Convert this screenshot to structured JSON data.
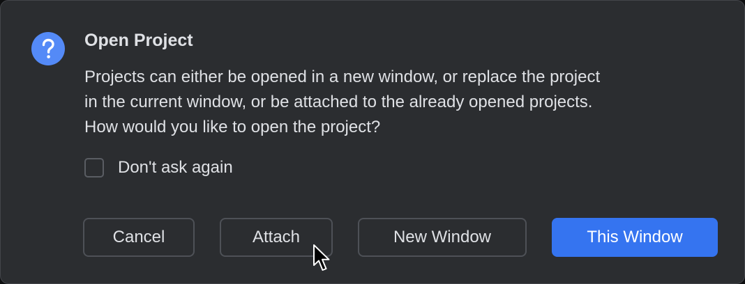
{
  "dialog": {
    "title": "Open Project",
    "message_lines": [
      "Projects can either be opened in a new window, or replace the project",
      "in the current window, or be attached to the already opened projects.",
      "How would you like to open the project?"
    ],
    "icon": "question-icon",
    "checkbox": {
      "label": "Don't ask again",
      "checked": false
    },
    "buttons": {
      "cancel": "Cancel",
      "attach": "Attach",
      "new_window": "New Window",
      "this_window": "This Window"
    },
    "colors": {
      "background": "#2b2d30",
      "accent": "#3574f0",
      "icon_blue": "#548af7",
      "text": "#dfe1e5"
    }
  }
}
